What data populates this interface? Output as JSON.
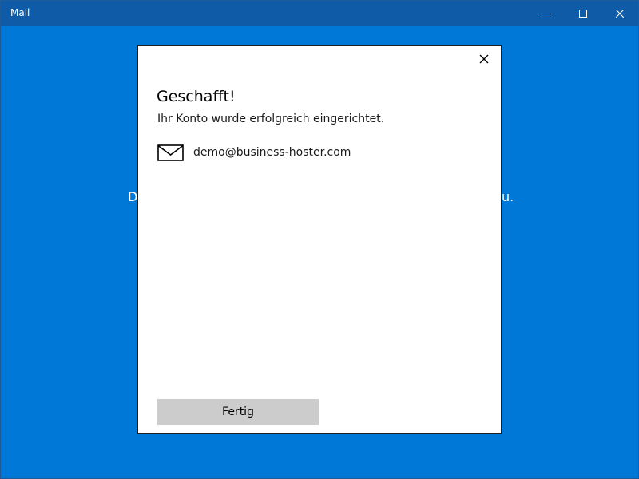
{
  "window": {
    "title": "Mail",
    "controls": {
      "minimize_icon": "minimize-icon",
      "maximize_icon": "maximize-icon",
      "close_icon": "close-icon"
    }
  },
  "background": {
    "text_left_fragment": "D",
    "text_right_fragment": "u."
  },
  "dialog": {
    "title": "Geschafft!",
    "subtitle": "Ihr Konto wurde erfolgreich eingerichtet.",
    "account": {
      "icon": "mail-icon",
      "email": "demo@business-hoster.com"
    },
    "done_button_label": "Fertig",
    "close_icon": "close-icon"
  },
  "colors": {
    "accent": "#0078d7",
    "titlebar": "#0f5ba8",
    "button_bg": "#cccccc",
    "dialog_bg": "#ffffff"
  }
}
